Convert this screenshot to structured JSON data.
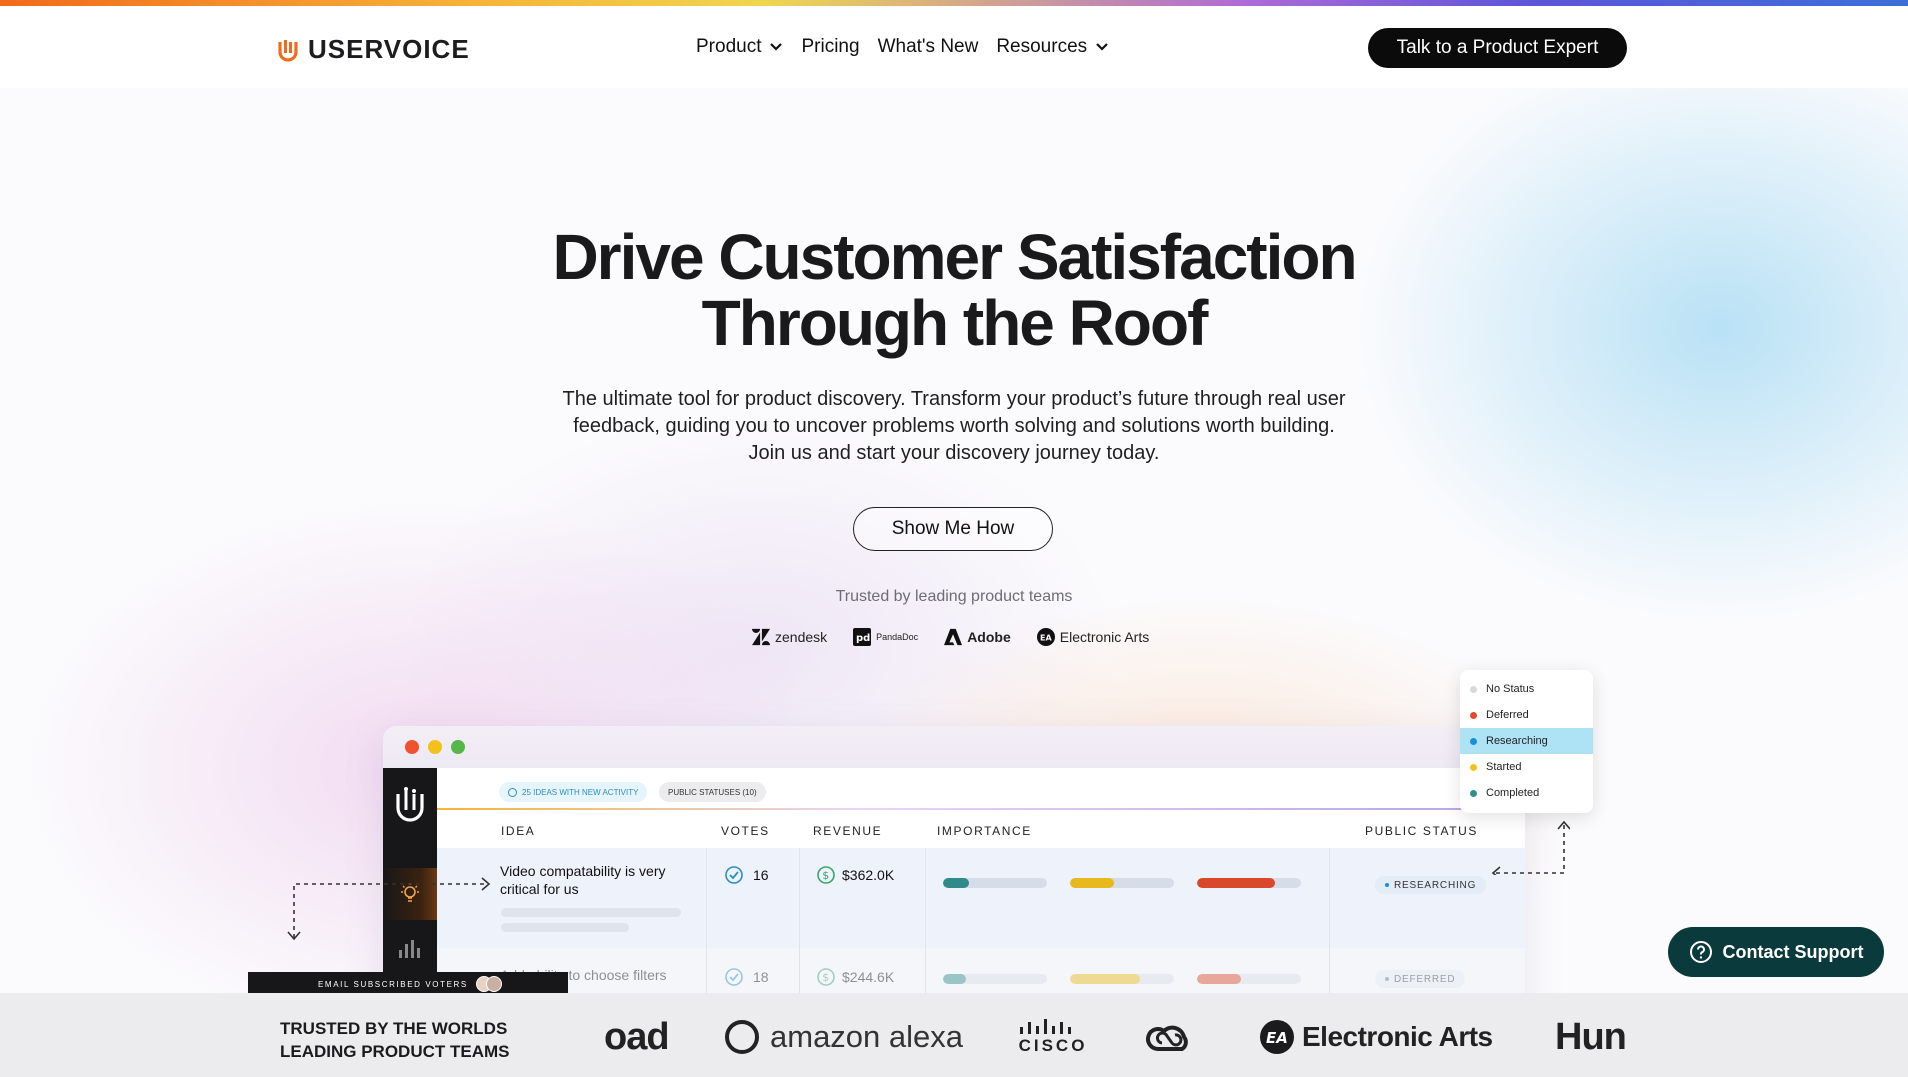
{
  "header": {
    "brand": "USERVOICE",
    "nav": [
      {
        "label": "Product",
        "dropdown": true
      },
      {
        "label": "Pricing",
        "dropdown": false
      },
      {
        "label": "What's New",
        "dropdown": false
      },
      {
        "label": "Resources",
        "dropdown": true
      }
    ],
    "cta": "Talk to a Product Expert"
  },
  "hero": {
    "title_line1": "Drive Customer Satisfaction",
    "title_line2": "Through the Roof",
    "subtitle_line1": "The ultimate tool for product discovery. Transform your product’s future through real user",
    "subtitle_line2": "feedback, guiding you to uncover problems worth solving and solutions worth building.",
    "subtitle_line3": "Join us and start your discovery journey today.",
    "button": "Show Me How",
    "trusted": "Trusted by leading product teams",
    "logos": [
      "zendesk",
      "PandaDoc",
      "Adobe",
      "Electronic Arts"
    ]
  },
  "mockup": {
    "chips": [
      "25 IDEAS WITH NEW ACTIVITY",
      "PUBLIC STATUSES (10)"
    ],
    "columns": [
      "IDEA",
      "VOTES",
      "REVENUE",
      "IMPORTANCE",
      "PUBLIC STATUS"
    ],
    "rows": [
      {
        "idea": "Video compatability is very critical for us",
        "votes": "16",
        "revenue": "$362.0K",
        "importance": [
          0.25,
          0.42,
          0.75
        ],
        "status": "RESEARCHING"
      },
      {
        "idea": "Add ability to choose filters",
        "votes": "18",
        "revenue": "$244.6K",
        "importance": [
          0.22,
          0.67,
          0.42
        ],
        "status": "DEFERRED"
      }
    ],
    "status_menu": [
      {
        "label": "No Status",
        "color": "#d8d8d8"
      },
      {
        "label": "Deferred",
        "color": "#e24b2a"
      },
      {
        "label": "Researching",
        "color": "#1a8fd6",
        "active": true
      },
      {
        "label": "Started",
        "color": "#f2c21b"
      },
      {
        "label": "Completed",
        "color": "#2f8f8b"
      }
    ],
    "email_strip": "EMAIL SUBSCRIBED VOTERS"
  },
  "bottom": {
    "title_line1": "TRUSTED BY THE WORLDS",
    "title_line2": "LEADING PRODUCT TEAMS",
    "logos": [
      "oad",
      "amazon alexa",
      "cisco",
      "Creative Cloud",
      "Electronic Arts",
      "Hun"
    ]
  },
  "contact_support": "Contact Support",
  "colors": {
    "brand_orange": "#f26a1b",
    "dark": "#0b0b0c",
    "support_teal": "#0b3a3c"
  }
}
